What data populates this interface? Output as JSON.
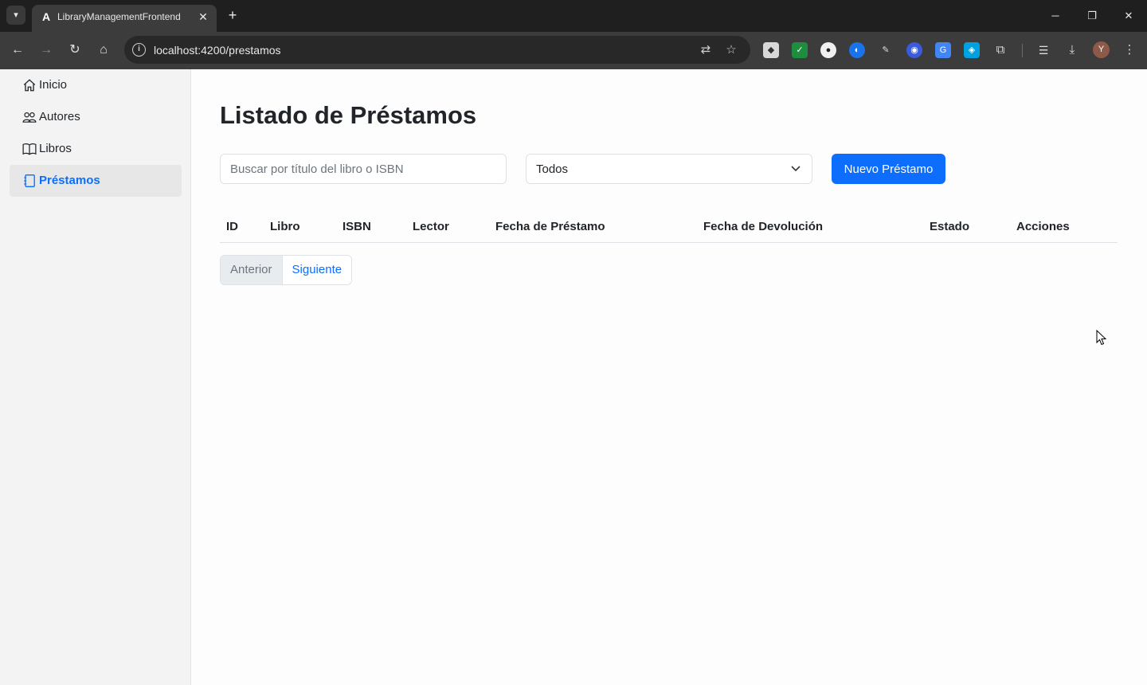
{
  "browser": {
    "tab_title": "LibraryManagementFrontend",
    "url": "localhost:4200/prestamos",
    "profile_initial": "Y"
  },
  "sidebar": {
    "items": [
      {
        "label": "Inicio",
        "icon": "house-icon"
      },
      {
        "label": "Autores",
        "icon": "people-icon"
      },
      {
        "label": "Libros",
        "icon": "book-icon"
      },
      {
        "label": "Préstamos",
        "icon": "journal-icon",
        "active": true
      }
    ]
  },
  "main": {
    "title": "Listado de Préstamos",
    "search_placeholder": "Buscar por título del libro o ISBN",
    "filter_value": "Todos",
    "new_button": "Nuevo Préstamo",
    "table_headers": [
      "ID",
      "Libro",
      "ISBN",
      "Lector",
      "Fecha de Préstamo",
      "Fecha de Devolución",
      "Estado",
      "Acciones"
    ],
    "pagination": {
      "prev": "Anterior",
      "next": "Siguiente"
    }
  },
  "colors": {
    "primary": "#0d6efd",
    "sidebar_bg": "#f3f3f3"
  }
}
